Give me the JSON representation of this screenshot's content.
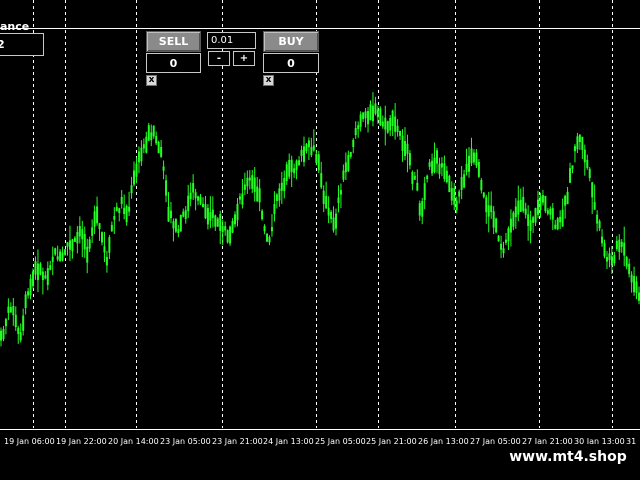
{
  "panel": {
    "balance_label": "ance",
    "balance_value": "2",
    "sell_label": "SELL",
    "buy_label": "BUY",
    "lot_value": "0.01",
    "minus_label": "-",
    "plus_label": "+",
    "sell_count": "0",
    "buy_count": "0",
    "close_label": "x"
  },
  "watermark": "www.mt4.shop",
  "colors": {
    "background": "#000000",
    "candle": "#22ff22",
    "grid": "#ffffff",
    "button": "#8a8a8a"
  },
  "chart_data": {
    "type": "candlestick",
    "x_tick_labels": [
      "19 Jan 06:00",
      "19 Jan 22:00",
      "20 Jan 14:00",
      "23 Jan 05:00",
      "23 Jan 21:00",
      "24 Jan 13:00",
      "25 Jan 05:00",
      "25 Jan 21:00",
      "26 Jan 13:00",
      "27 Jan 05:00",
      "27 Jan 21:00",
      "30 Jan 13:00",
      "31"
    ],
    "grid": "vertical-dashed",
    "close_path": [
      0.15,
      0.22,
      0.28,
      0.2,
      0.14,
      0.3,
      0.35,
      0.42,
      0.4,
      0.38,
      0.45,
      0.47,
      0.44,
      0.5,
      0.49,
      0.52,
      0.55,
      0.48,
      0.56,
      0.6,
      0.52,
      0.42,
      0.58,
      0.63,
      0.66,
      0.6,
      0.72,
      0.8,
      0.85,
      0.9,
      0.93,
      0.87,
      0.8,
      0.62,
      0.58,
      0.55,
      0.6,
      0.65,
      0.7,
      0.68,
      0.64,
      0.62,
      0.6,
      0.58,
      0.56,
      0.5,
      0.58,
      0.66,
      0.7,
      0.74,
      0.72,
      0.68,
      0.55,
      0.52,
      0.62,
      0.7,
      0.74,
      0.77,
      0.79,
      0.82,
      0.84,
      0.86,
      0.84,
      0.78,
      0.66,
      0.6,
      0.58,
      0.7,
      0.78,
      0.84,
      0.92,
      0.95,
      0.98,
      1.0,
      0.99,
      0.97,
      0.93,
      0.96,
      0.94,
      0.9,
      0.86,
      0.78,
      0.72,
      0.62,
      0.76,
      0.8,
      0.82,
      0.78,
      0.74,
      0.7,
      0.66,
      0.72,
      0.78,
      0.82,
      0.8,
      0.7,
      0.64,
      0.62,
      0.56,
      0.48,
      0.52,
      0.6,
      0.62,
      0.64,
      0.6,
      0.58,
      0.62,
      0.66,
      0.64,
      0.6,
      0.56,
      0.62,
      0.7,
      0.82,
      0.9,
      0.86,
      0.78,
      0.66,
      0.58,
      0.48,
      0.44,
      0.46,
      0.5,
      0.48,
      0.4,
      0.36,
      0.3
    ]
  }
}
